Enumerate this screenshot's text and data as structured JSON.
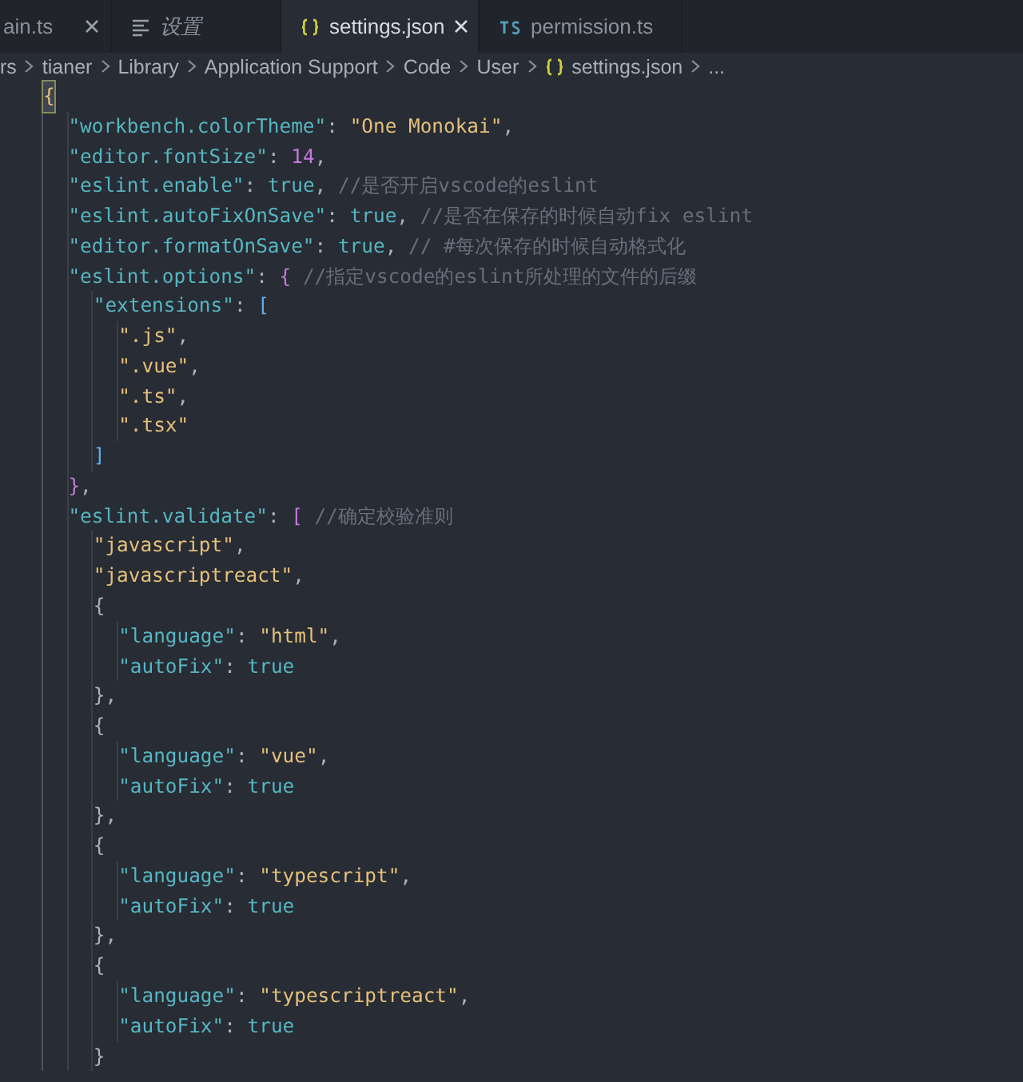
{
  "tabs": [
    {
      "label": "ain.ts",
      "kind": "plain",
      "selected": false,
      "preview": false,
      "closable": true
    },
    {
      "label": "设置",
      "kind": "settings",
      "selected": false,
      "preview": true,
      "closable": false
    },
    {
      "label": "settings.json",
      "kind": "json",
      "selected": true,
      "preview": false,
      "closable": true
    },
    {
      "label": "permission.ts",
      "kind": "typescript",
      "selected": false,
      "preview": false,
      "closable": false
    }
  ],
  "breadcrumb": [
    {
      "text": "rs",
      "kind": "folder"
    },
    {
      "text": "tianer",
      "kind": "folder"
    },
    {
      "text": "Library",
      "kind": "folder"
    },
    {
      "text": "Application Support",
      "kind": "folder"
    },
    {
      "text": "Code",
      "kind": "folder"
    },
    {
      "text": "User",
      "kind": "folder"
    },
    {
      "text": "settings.json",
      "kind": "json"
    },
    {
      "text": "...",
      "kind": "folder"
    }
  ],
  "code_lines": [
    {
      "tokens": [
        {
          "kind": "bracket1",
          "text": "{",
          "matched": true
        }
      ]
    },
    {
      "tokens": [
        {
          "kind": "key",
          "text": "  \"workbench.colorTheme\""
        },
        {
          "kind": "punct",
          "text": ": "
        },
        {
          "kind": "string",
          "text": "\"One Monokai\""
        },
        {
          "kind": "punct",
          "text": ","
        }
      ]
    },
    {
      "tokens": [
        {
          "kind": "key",
          "text": "  \"editor.fontSize\""
        },
        {
          "kind": "punct",
          "text": ": "
        },
        {
          "kind": "number",
          "text": "14"
        },
        {
          "kind": "punct",
          "text": ","
        }
      ]
    },
    {
      "tokens": [
        {
          "kind": "key",
          "text": "  \"eslint.enable\""
        },
        {
          "kind": "punct",
          "text": ": "
        },
        {
          "kind": "bool",
          "text": "true"
        },
        {
          "kind": "punct",
          "text": ", "
        },
        {
          "kind": "comment",
          "text": "//是否开启vscode的eslint"
        }
      ]
    },
    {
      "tokens": [
        {
          "kind": "key",
          "text": "  \"eslint.autoFixOnSave\""
        },
        {
          "kind": "punct",
          "text": ": "
        },
        {
          "kind": "bool",
          "text": "true"
        },
        {
          "kind": "punct",
          "text": ", "
        },
        {
          "kind": "comment",
          "text": "//是否在保存的时候自动fix eslint"
        }
      ]
    },
    {
      "tokens": [
        {
          "kind": "key",
          "text": "  \"editor.formatOnSave\""
        },
        {
          "kind": "punct",
          "text": ": "
        },
        {
          "kind": "bool",
          "text": "true"
        },
        {
          "kind": "punct",
          "text": ", "
        },
        {
          "kind": "comment",
          "text": "// #每次保存的时候自动格式化"
        }
      ]
    },
    {
      "tokens": [
        {
          "kind": "key",
          "text": "  \"eslint.options\""
        },
        {
          "kind": "punct",
          "text": ": "
        },
        {
          "kind": "bracket2",
          "text": "{"
        },
        {
          "kind": "comment",
          "text": " //指定vscode的eslint所处理的文件的后缀"
        }
      ]
    },
    {
      "tokens": [
        {
          "kind": "key",
          "text": "    \"extensions\""
        },
        {
          "kind": "punct",
          "text": ": "
        },
        {
          "kind": "bracket3",
          "text": "["
        }
      ]
    },
    {
      "tokens": [
        {
          "kind": "string",
          "text": "      \".js\""
        },
        {
          "kind": "punct",
          "text": ","
        }
      ]
    },
    {
      "tokens": [
        {
          "kind": "string",
          "text": "      \".vue\""
        },
        {
          "kind": "punct",
          "text": ","
        }
      ]
    },
    {
      "tokens": [
        {
          "kind": "string",
          "text": "      \".ts\""
        },
        {
          "kind": "punct",
          "text": ","
        }
      ]
    },
    {
      "tokens": [
        {
          "kind": "string",
          "text": "      \".tsx\""
        }
      ]
    },
    {
      "tokens": [
        {
          "kind": "bracket3",
          "text": "    ]"
        }
      ]
    },
    {
      "tokens": [
        {
          "kind": "bracket2",
          "text": "  }"
        },
        {
          "kind": "punct",
          "text": ","
        }
      ]
    },
    {
      "tokens": [
        {
          "kind": "key",
          "text": "  \"eslint.validate\""
        },
        {
          "kind": "punct",
          "text": ": "
        },
        {
          "kind": "bracket2",
          "text": "["
        },
        {
          "kind": "comment",
          "text": " //确定校验准则"
        }
      ]
    },
    {
      "tokens": [
        {
          "kind": "string",
          "text": "    \"javascript\""
        },
        {
          "kind": "punct",
          "text": ","
        }
      ]
    },
    {
      "tokens": [
        {
          "kind": "string",
          "text": "    \"javascriptreact\""
        },
        {
          "kind": "punct",
          "text": ","
        }
      ]
    },
    {
      "tokens": [
        {
          "kind": "punct",
          "text": "    {"
        }
      ]
    },
    {
      "tokens": [
        {
          "kind": "key",
          "text": "      \"language\""
        },
        {
          "kind": "punct",
          "text": ": "
        },
        {
          "kind": "string",
          "text": "\"html\""
        },
        {
          "kind": "punct",
          "text": ","
        }
      ]
    },
    {
      "tokens": [
        {
          "kind": "key",
          "text": "      \"autoFix\""
        },
        {
          "kind": "punct",
          "text": ": "
        },
        {
          "kind": "bool",
          "text": "true"
        }
      ]
    },
    {
      "tokens": [
        {
          "kind": "punct",
          "text": "    },"
        }
      ]
    },
    {
      "tokens": [
        {
          "kind": "punct",
          "text": "    {"
        }
      ]
    },
    {
      "tokens": [
        {
          "kind": "key",
          "text": "      \"language\""
        },
        {
          "kind": "punct",
          "text": ": "
        },
        {
          "kind": "string",
          "text": "\"vue\""
        },
        {
          "kind": "punct",
          "text": ","
        }
      ]
    },
    {
      "tokens": [
        {
          "kind": "key",
          "text": "      \"autoFix\""
        },
        {
          "kind": "punct",
          "text": ": "
        },
        {
          "kind": "bool",
          "text": "true"
        }
      ]
    },
    {
      "tokens": [
        {
          "kind": "punct",
          "text": "    },"
        }
      ]
    },
    {
      "tokens": [
        {
          "kind": "punct",
          "text": "    {"
        }
      ]
    },
    {
      "tokens": [
        {
          "kind": "key",
          "text": "      \"language\""
        },
        {
          "kind": "punct",
          "text": ": "
        },
        {
          "kind": "string",
          "text": "\"typescript\""
        },
        {
          "kind": "punct",
          "text": ","
        }
      ]
    },
    {
      "tokens": [
        {
          "kind": "key",
          "text": "      \"autoFix\""
        },
        {
          "kind": "punct",
          "text": ": "
        },
        {
          "kind": "bool",
          "text": "true"
        }
      ]
    },
    {
      "tokens": [
        {
          "kind": "punct",
          "text": "    },"
        }
      ]
    },
    {
      "tokens": [
        {
          "kind": "punct",
          "text": "    {"
        }
      ]
    },
    {
      "tokens": [
        {
          "kind": "key",
          "text": "      \"language\""
        },
        {
          "kind": "punct",
          "text": ": "
        },
        {
          "kind": "string",
          "text": "\"typescriptreact\""
        },
        {
          "kind": "punct",
          "text": ","
        }
      ]
    },
    {
      "tokens": [
        {
          "kind": "key",
          "text": "      \"autoFix\""
        },
        {
          "kind": "punct",
          "text": ": "
        },
        {
          "kind": "bool",
          "text": "true"
        }
      ]
    },
    {
      "tokens": [
        {
          "kind": "punct",
          "text": "    }"
        }
      ]
    }
  ]
}
